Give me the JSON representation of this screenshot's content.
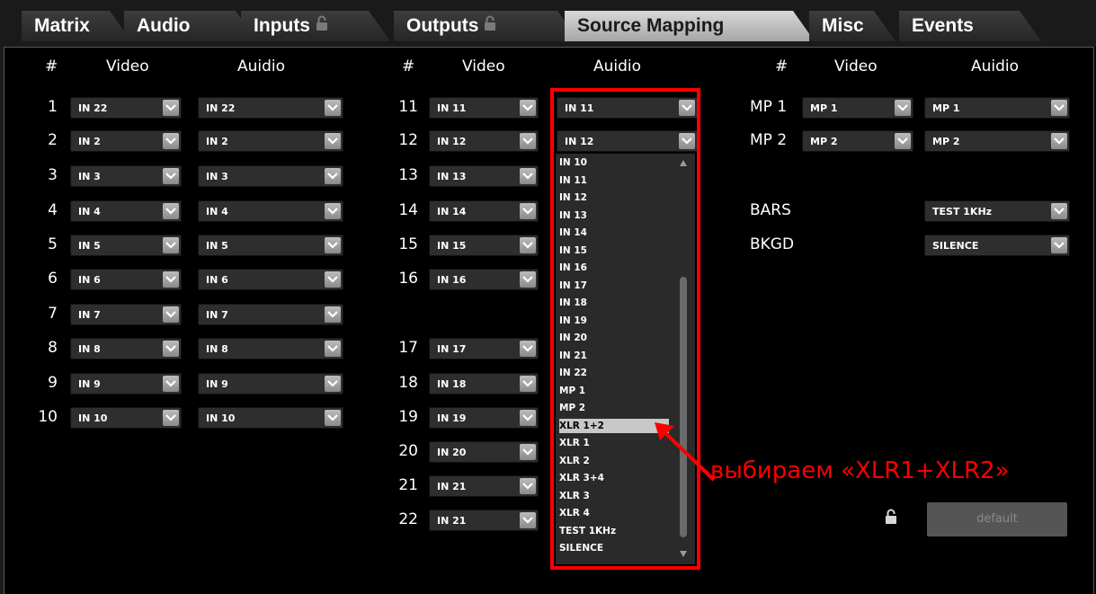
{
  "tabs": [
    {
      "label": "Matrix",
      "locked": false
    },
    {
      "label": "Audio",
      "locked": false
    },
    {
      "label": "Inputs",
      "locked": true
    },
    {
      "label": "Outputs",
      "locked": true
    },
    {
      "label": "Source Mapping",
      "locked": false,
      "active": true
    },
    {
      "label": "Misc",
      "locked": false
    },
    {
      "label": "Events",
      "locked": false
    }
  ],
  "headers": {
    "num": "#",
    "video": "Video",
    "audio": "Auidio"
  },
  "col1": [
    {
      "n": "1",
      "video": "IN 22",
      "audio": "IN 22"
    },
    {
      "n": "2",
      "video": "IN 2",
      "audio": "IN 2"
    },
    {
      "n": "3",
      "video": "IN 3",
      "audio": "IN 3"
    },
    {
      "n": "4",
      "video": "IN 4",
      "audio": "IN 4"
    },
    {
      "n": "5",
      "video": "IN 5",
      "audio": "IN 5"
    },
    {
      "n": "6",
      "video": "IN 6",
      "audio": "IN 6"
    },
    {
      "n": "7",
      "video": "IN 7",
      "audio": "IN 7"
    },
    {
      "n": "8",
      "video": "IN 8",
      "audio": "IN 8"
    },
    {
      "n": "9",
      "video": "IN 9",
      "audio": "IN 9"
    },
    {
      "n": "10",
      "video": "IN 10",
      "audio": "IN 10"
    }
  ],
  "col2": [
    {
      "n": "11",
      "video": "IN 11",
      "audio": "IN 11"
    },
    {
      "n": "12",
      "video": "IN 12",
      "audio": "IN 12"
    },
    {
      "n": "13",
      "video": "IN 13"
    },
    {
      "n": "14",
      "video": "IN 14"
    },
    {
      "n": "15",
      "video": "IN 15"
    },
    {
      "n": "16",
      "video": "IN 16"
    },
    {
      "n": "17",
      "video": "IN 17"
    },
    {
      "n": "18",
      "video": "IN 18"
    },
    {
      "n": "19",
      "video": "IN 19"
    },
    {
      "n": "20",
      "video": "IN 20"
    },
    {
      "n": "21",
      "video": "IN 21"
    },
    {
      "n": "22",
      "video": "IN 21"
    }
  ],
  "col3": [
    {
      "n": "MP 1",
      "video": "MP 1",
      "audio": "MP 1"
    },
    {
      "n": "MP 2",
      "video": "MP 2",
      "audio": "MP 2"
    }
  ],
  "extras": [
    {
      "label": "BARS",
      "value": "TEST 1KHz"
    },
    {
      "label": "BKGD",
      "value": "SILENCE"
    }
  ],
  "dropdown_options": [
    "IN 10",
    "IN 11",
    "IN 12",
    "IN 13",
    "IN 14",
    "IN 15",
    "IN 16",
    "IN 17",
    "IN 18",
    "IN 19",
    "IN 20",
    "IN 21",
    "IN 22",
    "MP 1",
    "MP 2",
    "XLR 1+2",
    "XLR 1",
    "XLR 2",
    "XLR 3+4",
    "XLR 3",
    "XLR 4",
    "TEST 1KHz",
    "SILENCE"
  ],
  "dropdown_highlighted": "XLR 1+2",
  "annotation": "выбираем «XLR1+XLR2»",
  "default_button": "default",
  "colors": {
    "accent_red": "#ff0000",
    "active_tab": "#c8c8c8",
    "highlight": "#c8c8c8"
  }
}
